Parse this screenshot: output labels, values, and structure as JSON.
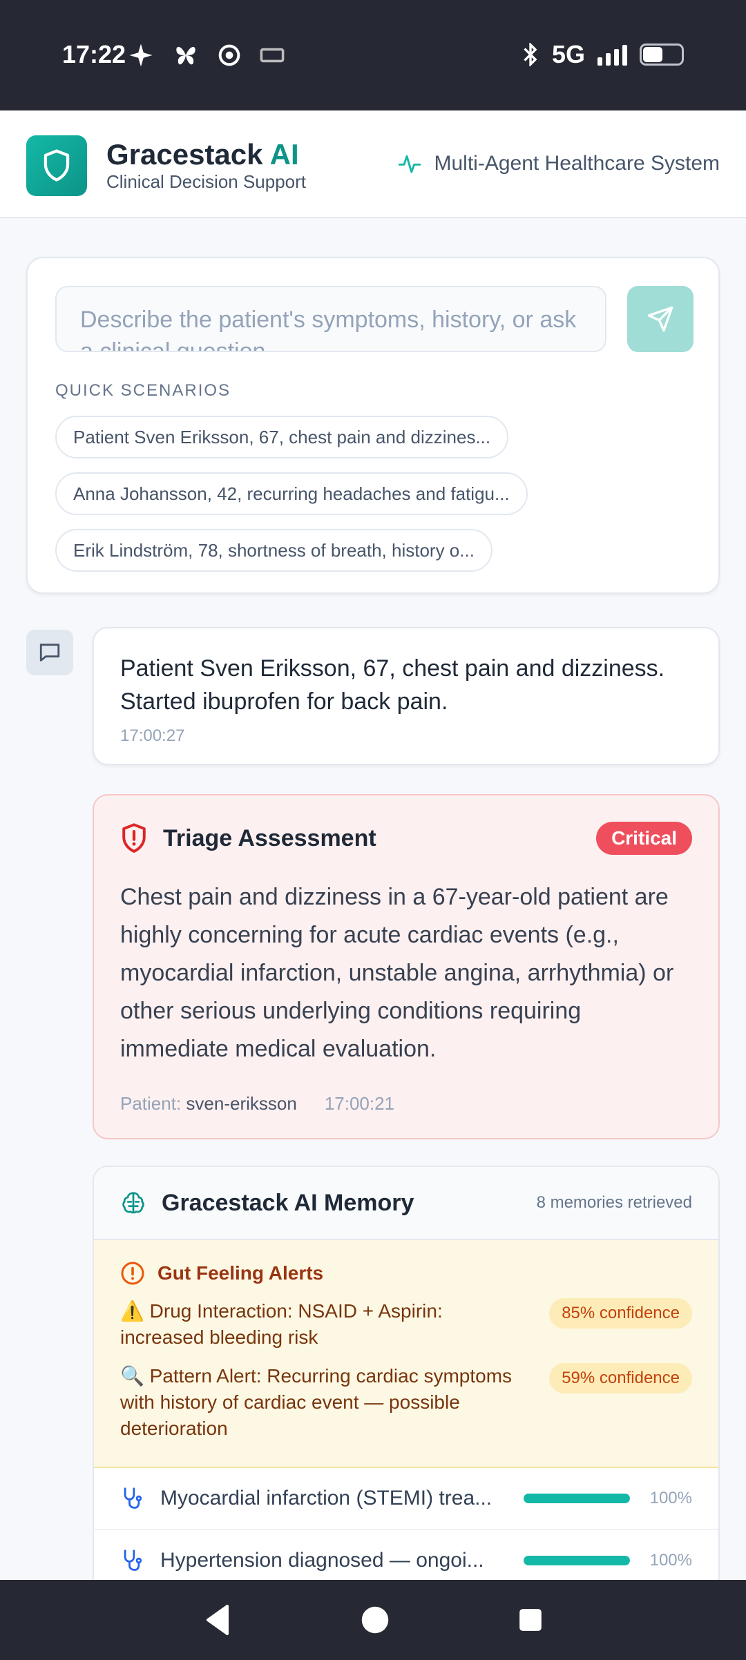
{
  "status_bar": {
    "time": "17:22",
    "network": "5G"
  },
  "header": {
    "brand_name": "Gracestack",
    "brand_ai": "AI",
    "subtitle": "Clinical Decision Support",
    "system_label": "Multi-Agent Healthcare System"
  },
  "input": {
    "placeholder": "Describe the patient's symptoms, history, or ask a clinical question"
  },
  "quick_scenarios": {
    "label": "QUICK SCENARIOS",
    "items": [
      "Patient Sven Eriksson, 67, chest pain and dizzines...",
      "Anna Johansson, 42, recurring headaches and fatigu...",
      "Erik Lindström, 78, shortness of breath, history o..."
    ]
  },
  "user_message": {
    "text": "Patient Sven Eriksson, 67, chest pain and dizziness. Started ibuprofen for back pain.",
    "time": "17:00:27"
  },
  "triage": {
    "title": "Triage Assessment",
    "severity": "Critical",
    "body": "Chest pain and dizziness in a 67-year-old patient are highly concerning for acute cardiac events (e.g., myocardial infarction, unstable angina, arrhythmia) or other serious underlying conditions requiring immediate medical evaluation.",
    "patient_label": "Patient:",
    "patient_id": "sven-eriksson",
    "time": "17:00:21"
  },
  "memory": {
    "title": "Gracestack AI Memory",
    "count": "8 memories retrieved",
    "alerts_title": "Gut Feeling Alerts",
    "alerts": [
      {
        "text": "⚠️ Drug Interaction: NSAID + Aspirin: increased bleeding risk",
        "confidence": "85% confidence"
      },
      {
        "text": "🔍 Pattern Alert: Recurring cardiac symptoms with history of cardiac event — possible deterioration",
        "confidence": "59% confidence"
      }
    ],
    "items": [
      {
        "label": "Myocardial infarction (STEMI) trea...",
        "percent": "100%",
        "fill": 1.0
      },
      {
        "label": "Hypertension diagnosed — ongoi...",
        "percent": "100%",
        "fill": 1.0
      }
    ]
  },
  "colors": {
    "accent": "#14b8a6",
    "critical": "#ef4f5c",
    "alert_bg": "#fdf8e3"
  }
}
